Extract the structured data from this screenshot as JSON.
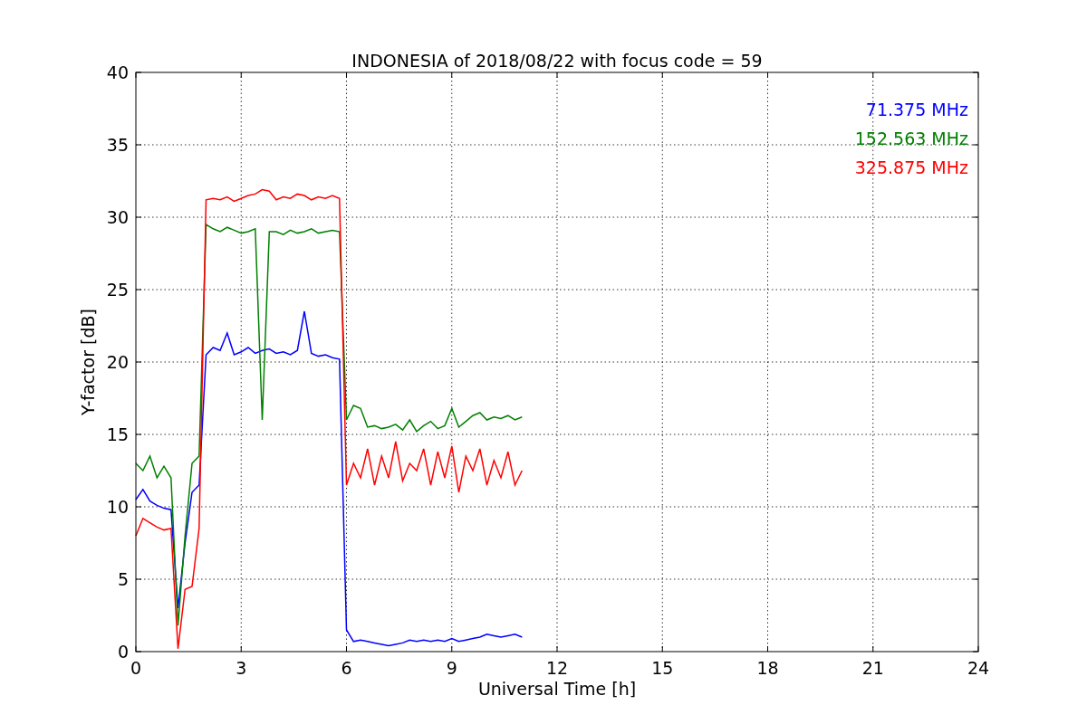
{
  "chart_data": {
    "type": "line",
    "title": "INDONESIA of 2018/08/22 with focus code = 59",
    "xlabel": "Universal Time [h]",
    "ylabel": "Y-factor [dB]",
    "grid": true,
    "xlim": [
      0,
      24
    ],
    "ylim": [
      0,
      40
    ],
    "xticks": [
      0,
      3,
      6,
      9,
      12,
      15,
      18,
      21,
      24
    ],
    "yticks": [
      0,
      5,
      10,
      15,
      20,
      25,
      30,
      35,
      40
    ],
    "x": [
      0,
      0.2,
      0.4,
      0.6,
      0.8,
      1.0,
      1.2,
      1.4,
      1.6,
      1.8,
      2.0,
      2.2,
      2.4,
      2.6,
      2.8,
      3.0,
      3.2,
      3.4,
      3.6,
      3.8,
      4.0,
      4.2,
      4.4,
      4.6,
      4.8,
      5.0,
      5.2,
      5.4,
      5.6,
      5.8,
      6.0,
      6.2,
      6.4,
      6.6,
      6.8,
      7.0,
      7.2,
      7.4,
      7.6,
      7.8,
      8.0,
      8.2,
      8.4,
      8.6,
      8.8,
      9.0,
      9.2,
      9.4,
      9.6,
      9.8,
      10.0,
      10.2,
      10.4,
      10.6,
      10.8,
      11.0
    ],
    "series": [
      {
        "name": "71.375 MHz",
        "color": "#0000ff",
        "values": [
          10.5,
          11.2,
          10.4,
          10.1,
          9.9,
          9.8,
          3.0,
          7.5,
          11.0,
          11.5,
          20.5,
          21.0,
          20.8,
          22.0,
          20.5,
          20.7,
          21.0,
          20.6,
          20.8,
          20.9,
          20.6,
          20.7,
          20.5,
          20.8,
          23.5,
          20.6,
          20.4,
          20.5,
          20.3,
          20.2,
          1.5,
          0.7,
          0.8,
          0.7,
          0.6,
          0.5,
          0.4,
          0.5,
          0.6,
          0.8,
          0.7,
          0.8,
          0.7,
          0.8,
          0.7,
          0.9,
          0.7,
          0.8,
          0.9,
          1.0,
          1.2,
          1.1,
          1.0,
          1.1,
          1.2,
          1.0
        ]
      },
      {
        "name": "152.563 MHz",
        "color": "#008000",
        "values": [
          13.0,
          12.5,
          13.5,
          12.0,
          12.8,
          12.0,
          1.8,
          8.0,
          13.0,
          13.5,
          29.5,
          29.2,
          29.0,
          29.3,
          29.1,
          28.9,
          29.0,
          29.2,
          16.0,
          29.0,
          29.0,
          28.8,
          29.1,
          28.9,
          29.0,
          29.2,
          28.9,
          29.0,
          29.1,
          29.0,
          16.0,
          17.0,
          16.8,
          15.5,
          15.6,
          15.4,
          15.5,
          15.7,
          15.3,
          16.0,
          15.2,
          15.6,
          15.9,
          15.4,
          15.6,
          16.8,
          15.5,
          15.9,
          16.3,
          16.5,
          16.0,
          16.2,
          16.1,
          16.3,
          16.0,
          16.2
        ]
      },
      {
        "name": "325.875 MHz",
        "color": "#ff0000",
        "values": [
          8.0,
          9.2,
          8.9,
          8.6,
          8.4,
          8.5,
          0.2,
          4.3,
          4.5,
          8.5,
          31.2,
          31.3,
          31.2,
          31.4,
          31.1,
          31.3,
          31.5,
          31.6,
          31.9,
          31.8,
          31.2,
          31.4,
          31.3,
          31.6,
          31.5,
          31.2,
          31.4,
          31.3,
          31.5,
          31.3,
          11.5,
          13.0,
          12.0,
          14.0,
          11.5,
          13.5,
          12.0,
          14.5,
          11.8,
          13.0,
          12.5,
          14.0,
          11.5,
          13.8,
          12.0,
          14.2,
          11.0,
          13.5,
          12.5,
          14.0,
          11.5,
          13.2,
          12.0,
          13.8,
          11.5,
          12.5
        ]
      }
    ]
  }
}
